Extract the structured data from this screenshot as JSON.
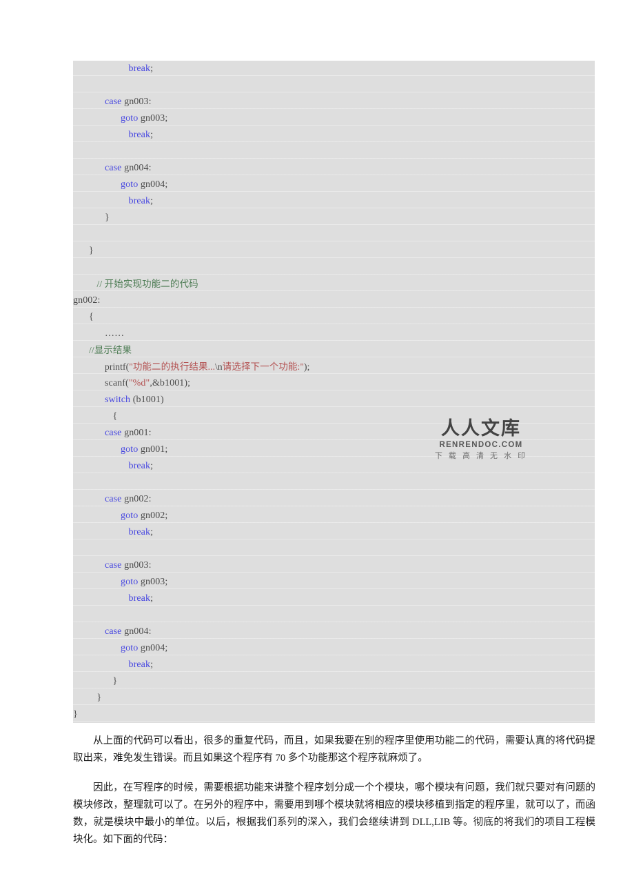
{
  "document": {
    "type": "code-listing-page",
    "page_background": "#ffffff",
    "code_block": {
      "background": "#dedede",
      "language": "c",
      "colors": {
        "keyword": "#4646e0",
        "identifier": "#4b4b4b",
        "comment": "#4d7c54",
        "string": "#b35050"
      },
      "lines": [
        {
          "indent": 7,
          "tokens": [
            {
              "t": "kw",
              "v": "break"
            },
            {
              "t": "pun",
              "v": ";"
            }
          ]
        },
        {
          "indent": 0,
          "tokens": []
        },
        {
          "indent": 4,
          "tokens": [
            {
              "t": "kw",
              "v": "case"
            },
            {
              "t": "id",
              "v": " gn003:"
            }
          ]
        },
        {
          "indent": 6,
          "tokens": [
            {
              "t": "kw",
              "v": "goto"
            },
            {
              "t": "id",
              "v": " gn003;"
            }
          ]
        },
        {
          "indent": 7,
          "tokens": [
            {
              "t": "kw",
              "v": "break"
            },
            {
              "t": "pun",
              "v": ";"
            }
          ]
        },
        {
          "indent": 0,
          "tokens": []
        },
        {
          "indent": 4,
          "tokens": [
            {
              "t": "kw",
              "v": "case"
            },
            {
              "t": "id",
              "v": " gn004:"
            }
          ]
        },
        {
          "indent": 6,
          "tokens": [
            {
              "t": "kw",
              "v": "goto"
            },
            {
              "t": "id",
              "v": " gn004;"
            }
          ]
        },
        {
          "indent": 7,
          "tokens": [
            {
              "t": "kw",
              "v": "break"
            },
            {
              "t": "pun",
              "v": ";"
            }
          ]
        },
        {
          "indent": 4,
          "tokens": [
            {
              "t": "pun",
              "v": "}"
            }
          ]
        },
        {
          "indent": 0,
          "tokens": []
        },
        {
          "indent": 2,
          "tokens": [
            {
              "t": "pun",
              "v": "}"
            }
          ]
        },
        {
          "indent": 0,
          "tokens": []
        },
        {
          "indent": 3,
          "cjk": true,
          "tokens": [
            {
              "t": "cmt",
              "v": "// 开始实现功能二的代码"
            }
          ]
        },
        {
          "indent": 0,
          "tokens": [
            {
              "t": "lbl",
              "v": "gn002:"
            }
          ]
        },
        {
          "indent": 2,
          "tokens": [
            {
              "t": "pun",
              "v": "{"
            }
          ]
        },
        {
          "indent": 4,
          "tokens": [
            {
              "t": "pun",
              "v": "……"
            }
          ]
        },
        {
          "indent": 2,
          "cjk": true,
          "tokens": [
            {
              "t": "cmt",
              "v": "//显示结果"
            }
          ]
        },
        {
          "indent": 4,
          "cjk": true,
          "tokens": [
            {
              "t": "id",
              "v": "printf("
            },
            {
              "t": "str",
              "v": "\"功能二的执行结果..."
            },
            {
              "t": "id",
              "v": "\\n"
            },
            {
              "t": "str",
              "v": "请选择下一个功能:\""
            },
            {
              "t": "id",
              "v": ");"
            }
          ]
        },
        {
          "indent": 4,
          "tokens": [
            {
              "t": "id",
              "v": "scanf("
            },
            {
              "t": "str",
              "v": "\"%d\""
            },
            {
              "t": "id",
              "v": ",&b1001);"
            }
          ]
        },
        {
          "indent": 4,
          "tokens": [
            {
              "t": "kw",
              "v": "switch"
            },
            {
              "t": "id",
              "v": " (b1001)"
            }
          ]
        },
        {
          "indent": 5,
          "tokens": [
            {
              "t": "pun",
              "v": "{"
            }
          ]
        },
        {
          "indent": 4,
          "tokens": [
            {
              "t": "kw",
              "v": "case"
            },
            {
              "t": "id",
              "v": " gn001:"
            }
          ]
        },
        {
          "indent": 6,
          "tokens": [
            {
              "t": "kw",
              "v": "goto"
            },
            {
              "t": "id",
              "v": " gn001;"
            }
          ]
        },
        {
          "indent": 7,
          "tokens": [
            {
              "t": "kw",
              "v": "break"
            },
            {
              "t": "pun",
              "v": ";"
            }
          ]
        },
        {
          "indent": 0,
          "tokens": []
        },
        {
          "indent": 4,
          "tokens": [
            {
              "t": "kw",
              "v": "case"
            },
            {
              "t": "id",
              "v": " gn002:"
            }
          ]
        },
        {
          "indent": 6,
          "tokens": [
            {
              "t": "kw",
              "v": "goto"
            },
            {
              "t": "id",
              "v": " gn002;"
            }
          ]
        },
        {
          "indent": 7,
          "tokens": [
            {
              "t": "kw",
              "v": "break"
            },
            {
              "t": "pun",
              "v": ";"
            }
          ]
        },
        {
          "indent": 0,
          "tokens": []
        },
        {
          "indent": 4,
          "tokens": [
            {
              "t": "kw",
              "v": "case"
            },
            {
              "t": "id",
              "v": " gn003:"
            }
          ]
        },
        {
          "indent": 6,
          "tokens": [
            {
              "t": "kw",
              "v": "goto"
            },
            {
              "t": "id",
              "v": " gn003;"
            }
          ]
        },
        {
          "indent": 7,
          "tokens": [
            {
              "t": "kw",
              "v": "break"
            },
            {
              "t": "pun",
              "v": ";"
            }
          ]
        },
        {
          "indent": 0,
          "tokens": []
        },
        {
          "indent": 4,
          "tokens": [
            {
              "t": "kw",
              "v": "case"
            },
            {
              "t": "id",
              "v": " gn004:"
            }
          ]
        },
        {
          "indent": 6,
          "tokens": [
            {
              "t": "kw",
              "v": "goto"
            },
            {
              "t": "id",
              "v": " gn004;"
            }
          ]
        },
        {
          "indent": 7,
          "tokens": [
            {
              "t": "kw",
              "v": "break"
            },
            {
              "t": "pun",
              "v": ";"
            }
          ]
        },
        {
          "indent": 5,
          "tokens": [
            {
              "t": "pun",
              "v": "}"
            }
          ]
        },
        {
          "indent": 3,
          "tokens": [
            {
              "t": "pun",
              "v": "}"
            }
          ]
        },
        {
          "indent": 0,
          "tokens": [
            {
              "t": "pun",
              "v": "}"
            }
          ]
        }
      ]
    },
    "watermark": {
      "title_cn": "人人文库",
      "site": "RENRENDOC.COM",
      "tagline": "下 载 高 清 无 水 印"
    },
    "prose": {
      "paragraphs": [
        "从上面的代码可以看出，很多的重复代码，而且，如果我要在别的程序里使用功能二的代码，需要认真的将代码提取出来，难免发生错误。而且如果这个程序有 70 多个功能那这个程序就麻烦了。",
        "因此，在写程序的时候，需要根据功能来讲整个程序划分成一个个模块，哪个模块有问题，我们就只要对有问题的模块修改，整理就可以了。在另外的程序中，需要用到哪个模块就将相应的模块移植到指定的程序里，就可以了，而函数，就是模块中最小的单位。以后，根据我们系列的深入，我们会继续讲到 DLL,LIB 等。彻底的将我们的项目工程模块化。如下面的代码："
      ]
    }
  }
}
